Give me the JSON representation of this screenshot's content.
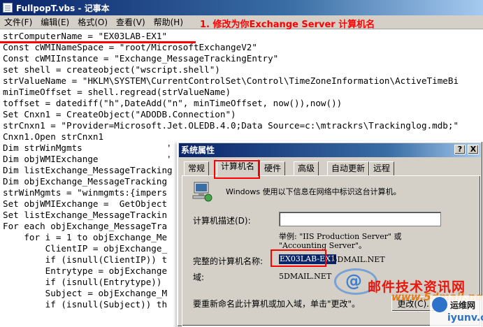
{
  "notepad": {
    "title": "FullpopT.vbs - 记事本",
    "menu": [
      "文件(F)",
      "编辑(E)",
      "格式(O)",
      "查看(V)",
      "帮助(H)"
    ]
  },
  "annotation": "1. 修改为你Exchange Server 计算机名",
  "code_lines": [
    "strComputerName = \"EX03LAB-EX1\"",
    "Const cWMINameSpace = \"root/MicrosoftExchangeV2\"",
    "Const cWMIInstance = \"Exchange_MessageTrackingEntry\"",
    "set shell = createobject(\"wscript.shell\")",
    "strValueName = \"HKLM\\SYSTEM\\CurrentControlSet\\Control\\TimeZoneInformation\\ActiveTimeBi",
    "minTimeOffset = shell.regread(strValueName)",
    "toffset = datediff(\"h\",DateAdd(\"n\", minTimeOffset, now()),now())",
    "Set Cnxn1 = CreateObject(\"ADODB.Connection\")",
    "strCnxn1 = \"Provider=Microsoft.Jet.OLEDB.4.0;Data Source=c:\\mtrackrs\\Trackinglog.mdb;\"",
    "Cnxn1.Open strCnxn1",
    "Dim strWinMgmts",
    "Dim objWMIExchange",
    "Dim listExchange_MessageTracking",
    "Dim objExchange_MessageTracking",
    "strWinMgmts = \"winmgmts:{impers",
    "Set objWMIExchange =  GetObject",
    "Set listExchange_MessageTrackin",
    "For each objExchange_MessageTra",
    "    for i = 1 to objExchange_Me",
    "        ClientIP = objExchange_",
    "        if (isnull(ClientIP)) t",
    "        Entrytype = objExchange",
    "        if (isnull(Entrytype))",
    "        Subject = objExchange_M",
    "        if (isnull(Subject)) th"
  ],
  "code_tail": {
    "line10": "'",
    "line11": "'"
  },
  "dialog": {
    "title": "系统属性",
    "help_button": "?",
    "close_button": "X",
    "tabs": [
      "常规",
      "计算机名",
      "硬件",
      "高级",
      "自动更新",
      "远程"
    ],
    "active_tab": "计算机名",
    "description": "Windows 使用以下信息在网络中标识这台计算机。",
    "comp_desc_label": "计算机描述(D):",
    "comp_desc_value": "",
    "example_line1": "举例: \"IIS Production Server\" 或",
    "example_line2": "\"Accounting Server\"。",
    "fullname_label": "完整的计算机名称:",
    "fullname_selected": "EX03LAB-EX1",
    "fullname_rest": ".5DMAIL.NET",
    "domain_label": "域:",
    "domain_value": "5DMAIL.NET",
    "rename_text": "要重新命名此计算机或加入域，单击\"更改\"。",
    "change_button": "更改(C)..."
  },
  "watermark": {
    "cn": "邮件技术资讯网",
    "url": "www.5dmail.net",
    "site2_top": "运维网",
    "site2_bottom": "iyunv.com"
  },
  "colors": {
    "annotation": "#ff0000",
    "titlebar": "#0a246a",
    "dialog_bg": "#d4d0c8"
  }
}
